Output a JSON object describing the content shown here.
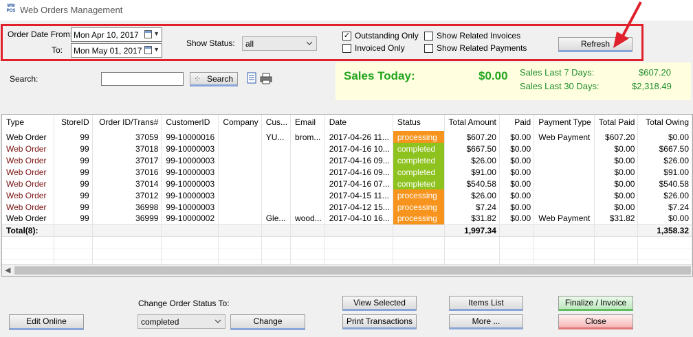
{
  "window": {
    "title": "Web Orders Management",
    "logo_text": "WW POS"
  },
  "filters": {
    "order_date_from_label": "Order Date From:",
    "to_label": "To:",
    "from_date": "Mon  Apr 10, 2017",
    "to_date": "Mon May 01, 2017",
    "show_status_label": "Show Status:",
    "status_value": "all",
    "outstanding_only": {
      "label": "Outstanding Only",
      "checked": true
    },
    "invoiced_only": {
      "label": "Invoiced Only",
      "checked": false
    },
    "show_related_invoices": {
      "label": "Show Related Invoices",
      "checked": false
    },
    "show_related_payments": {
      "label": "Show Related Payments",
      "checked": false
    },
    "refresh_label": "Refresh"
  },
  "search": {
    "label": "Search:",
    "value": "",
    "button_label": "Search"
  },
  "sales": {
    "today_label": "Sales Today:",
    "today_value": "$0.00",
    "last7_label": "Sales Last 7 Days:",
    "last7_value": "$607.20",
    "last30_label": "Sales Last 30 Days:",
    "last30_value": "$2,318.49"
  },
  "table": {
    "columns": [
      "Type",
      "StoreID",
      "Order ID/Trans#",
      "CustomerID",
      "Company",
      "Cus...",
      "Email",
      "Date",
      "Status",
      "Total Amount",
      "Paid",
      "Payment Type",
      "Total Paid",
      "Total Owing"
    ],
    "rows": [
      [
        "Web Order",
        "99",
        "37059",
        "99-10000016",
        "",
        "YU...",
        "brom...",
        "2017-04-26 11...",
        "processing",
        "$607.20",
        "$0.00",
        "Web Payment",
        "$607.20",
        "$0.00"
      ],
      [
        "Web Order",
        "99",
        "37018",
        "99-10000003",
        "",
        "",
        "",
        "2017-04-16 10...",
        "completed",
        "$667.50",
        "$0.00",
        "",
        "$0.00",
        "$667.50"
      ],
      [
        "Web Order",
        "99",
        "37017",
        "99-10000003",
        "",
        "",
        "",
        "2017-04-16 09...",
        "completed",
        "$26.00",
        "$0.00",
        "",
        "$0.00",
        "$26.00"
      ],
      [
        "Web Order",
        "99",
        "37016",
        "99-10000003",
        "",
        "",
        "",
        "2017-04-16 09...",
        "completed",
        "$91.00",
        "$0.00",
        "",
        "$0.00",
        "$91.00"
      ],
      [
        "Web Order",
        "99",
        "37014",
        "99-10000003",
        "",
        "",
        "",
        "2017-04-16 07...",
        "completed",
        "$540.58",
        "$0.00",
        "",
        "$0.00",
        "$540.58"
      ],
      [
        "Web Order",
        "99",
        "37012",
        "99-10000003",
        "",
        "",
        "",
        "2017-04-15 11...",
        "processing",
        "$26.00",
        "$0.00",
        "",
        "$0.00",
        "$26.00"
      ],
      [
        "Web Order",
        "99",
        "36998",
        "99-10000003",
        "",
        "",
        "",
        "2017-04-12 15...",
        "processing",
        "$7.24",
        "$0.00",
        "",
        "$0.00",
        "$7.24"
      ],
      [
        "Web Order",
        "99",
        "36999",
        "99-10000002",
        "",
        "Gle...",
        "wood...",
        "2017-04-10 16...",
        "processing",
        "$31.82",
        "$0.00",
        "Web Payment",
        "$31.82",
        "$0.00"
      ]
    ],
    "row_type_colors": [
      "#000000",
      "#7a1010",
      "#7a1010",
      "#7a1010",
      "#7a1010",
      "#7a1010",
      "#7a1010",
      "#000000"
    ],
    "total": {
      "label": "Total(8):",
      "total_amount": "1,997.34",
      "total_owing": "1,358.32"
    }
  },
  "bottom": {
    "edit_online_label": "Edit Online",
    "change_status_label": "Change Order Status To:",
    "change_status_value": "completed",
    "change_label": "Change",
    "view_selected_label": "View Selected",
    "print_transactions_label": "Print Transactions",
    "items_list_label": "Items List",
    "more_label": "More ...",
    "finalize_label": "Finalize / Invoice",
    "close_label": "Close"
  },
  "colors": {
    "highlight_border": "#e0202a",
    "arrow": "#e0202a",
    "processing": "#f7941d",
    "completed": "#8dc21f",
    "sales_green": "#22a41e"
  },
  "icons": [
    "app-logo-icon",
    "calendar-icon",
    "chevron-down-icon",
    "search-icon",
    "document-icon",
    "printer-icon",
    "scroll-left-icon",
    "red-arrow-annotation"
  ]
}
